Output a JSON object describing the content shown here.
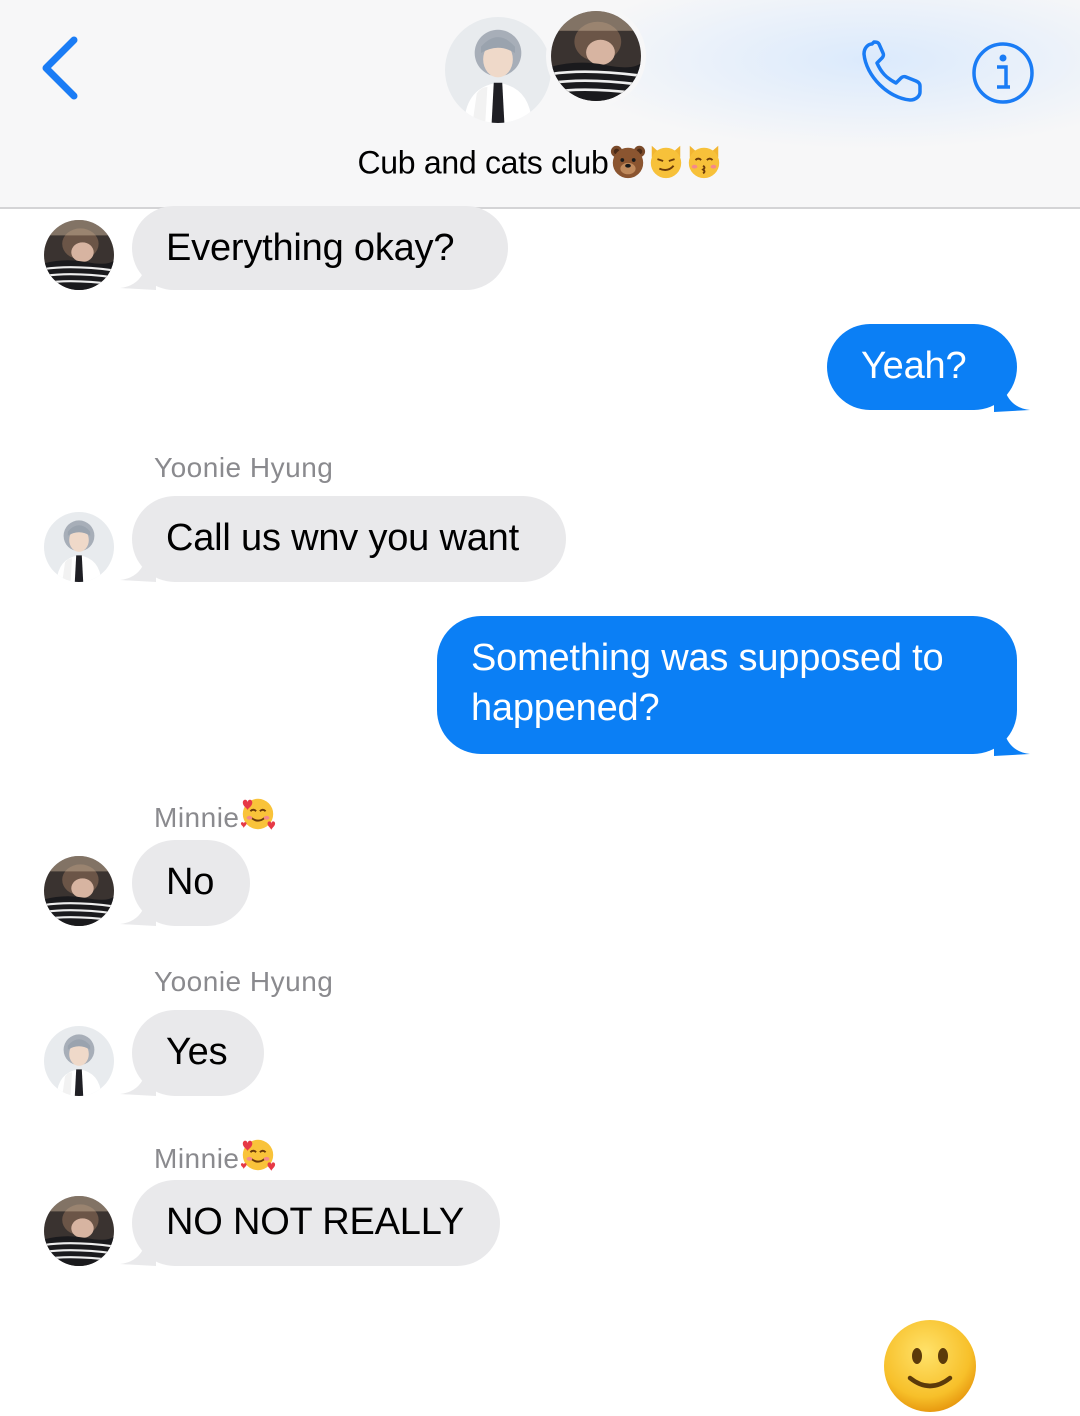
{
  "header": {
    "title": "Cub and cats club",
    "title_emojis": [
      "bear-face",
      "smirking-cat-face",
      "kissing-cat-face"
    ],
    "back_icon": "chevron-left-icon",
    "call_icon": "phone-icon",
    "info_icon": "info-icon",
    "accent_color": "#1a7cf5"
  },
  "participants": {
    "yoonie": {
      "name": "Yoonie Hyung"
    },
    "minnie": {
      "name": "Minnie",
      "name_emoji": "smiling-face-with-hearts"
    }
  },
  "messages": [
    {
      "direction": "in",
      "sender": "minnie",
      "text": "Everything okay?"
    },
    {
      "direction": "out",
      "text": "Yeah?"
    },
    {
      "direction": "in",
      "sender": "yoonie",
      "sender_label": "Yoonie Hyung",
      "text": "Call us wnv you want"
    },
    {
      "direction": "out",
      "text": "Something was supposed to happened?"
    },
    {
      "direction": "in",
      "sender": "minnie",
      "sender_label": "Minnie",
      "text": "No"
    },
    {
      "direction": "in",
      "sender": "yoonie",
      "sender_label": "Yoonie Hyung",
      "text": "Yes"
    },
    {
      "direction": "in",
      "sender": "minnie",
      "sender_label": "Minnie",
      "text": "NO NOT REALLY"
    }
  ],
  "reaction_emoji": "slightly-smiling-face",
  "colors": {
    "incoming_bubble": "#e9e9eb",
    "outgoing_bubble": "#0b7ff5",
    "sender_label": "#8a8a8e",
    "header_bg": "#f7f7f8"
  }
}
